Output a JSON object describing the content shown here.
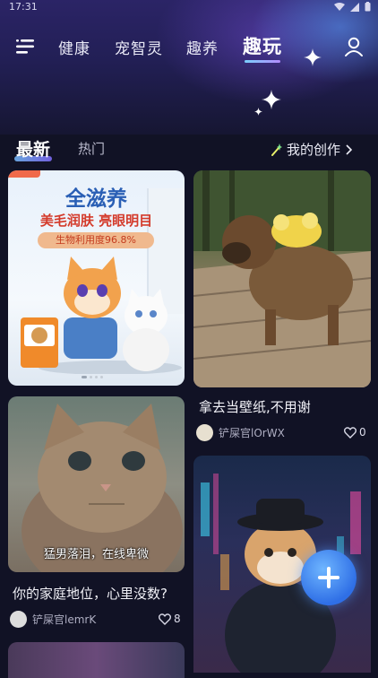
{
  "status": {
    "time": "17:31"
  },
  "nav": {
    "tabs": [
      {
        "label": "健康"
      },
      {
        "label": "宠智灵"
      },
      {
        "label": "趣养"
      },
      {
        "label": "趣玩"
      }
    ]
  },
  "subtabs": {
    "latest": "最新",
    "hot": "热门",
    "my_creation": "我的创作"
  },
  "cards": {
    "ad": {
      "title": "全滋养",
      "subtitle": "美毛润肤 亮眼明目",
      "tag": "生物利用度96.8%"
    },
    "dog": {
      "caption": "拿去当壁纸,不用谢",
      "author": "铲屎官lOrWX",
      "likes": "0"
    },
    "kitten": {
      "overlay": "猛男落泪，在线卑微",
      "caption": "你的家庭地位，心里没数?",
      "author": "铲屎官lemrK",
      "likes": "8"
    }
  },
  "fab_icon": "plus-icon"
}
